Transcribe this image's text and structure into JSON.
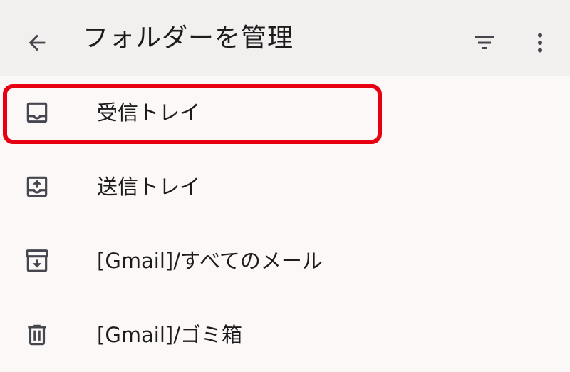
{
  "header": {
    "title": "フォルダーを管理",
    "back_icon": "arrow-back-icon",
    "filter_icon": "filter-list-icon",
    "more_icon": "more-vertical-icon"
  },
  "folders": [
    {
      "label": "受信トレイ",
      "icon": "inbox-icon"
    },
    {
      "label": "送信トレイ",
      "icon": "outbox-icon"
    },
    {
      "label": "[Gmail]/すべてのメール",
      "icon": "archive-icon"
    },
    {
      "label": "[Gmail]/ゴミ箱",
      "icon": "trash-icon"
    }
  ],
  "colors": {
    "app_bar": "#f2efef",
    "background": "#fcf8f8",
    "highlight": "#e60012",
    "icon": "#46464f"
  }
}
